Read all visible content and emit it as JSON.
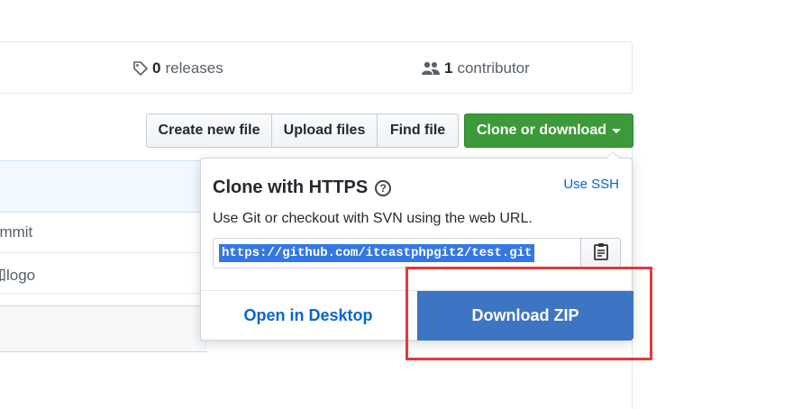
{
  "stats": {
    "releases_count": "0",
    "releases_label": "releases",
    "contributors_count": "1",
    "contributors_label": "contributor"
  },
  "toolbar": {
    "create_new_file": "Create new file",
    "upload_files": "Upload files",
    "find_file": "Find file",
    "clone_or_download": "Clone or download"
  },
  "file_list": {
    "row1_text": "ommit",
    "row2_text": "加logo"
  },
  "clone_dropdown": {
    "title": "Clone with HTTPS",
    "use_ssh": "Use SSH",
    "description": "Use Git or checkout with SVN using the web URL.",
    "url": "https://github.com/itcastphpgit2/test.git",
    "open_in_desktop": "Open in Desktop",
    "download_zip": "Download ZIP"
  },
  "colors": {
    "clone_button_green": "#3c9a3a",
    "download_zip_blue": "#3e75c3",
    "link_blue": "#0366d6",
    "highlight_red": "#e53935"
  }
}
